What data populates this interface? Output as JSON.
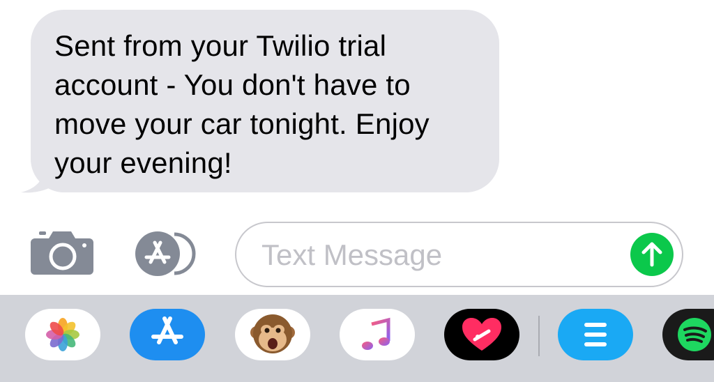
{
  "message": {
    "text": "Sent from your Twilio trial account - You don't have to move your car tonight. Enjoy your evening!"
  },
  "composer": {
    "placeholder": "Text Message"
  },
  "app_drawer": {
    "apps": [
      {
        "icon": "photos-icon"
      },
      {
        "icon": "app-store-icon"
      },
      {
        "icon": "animoji-monkey-icon"
      },
      {
        "icon": "music-icon"
      },
      {
        "icon": "digital-touch-icon"
      },
      {
        "icon": "app-list-icon"
      },
      {
        "icon": "spotify-icon"
      }
    ]
  },
  "colors": {
    "bubble": "#e5e5ea",
    "send": "#0bc84b",
    "drawer": "#d1d3d9",
    "app_store": "#1e8ef0"
  }
}
